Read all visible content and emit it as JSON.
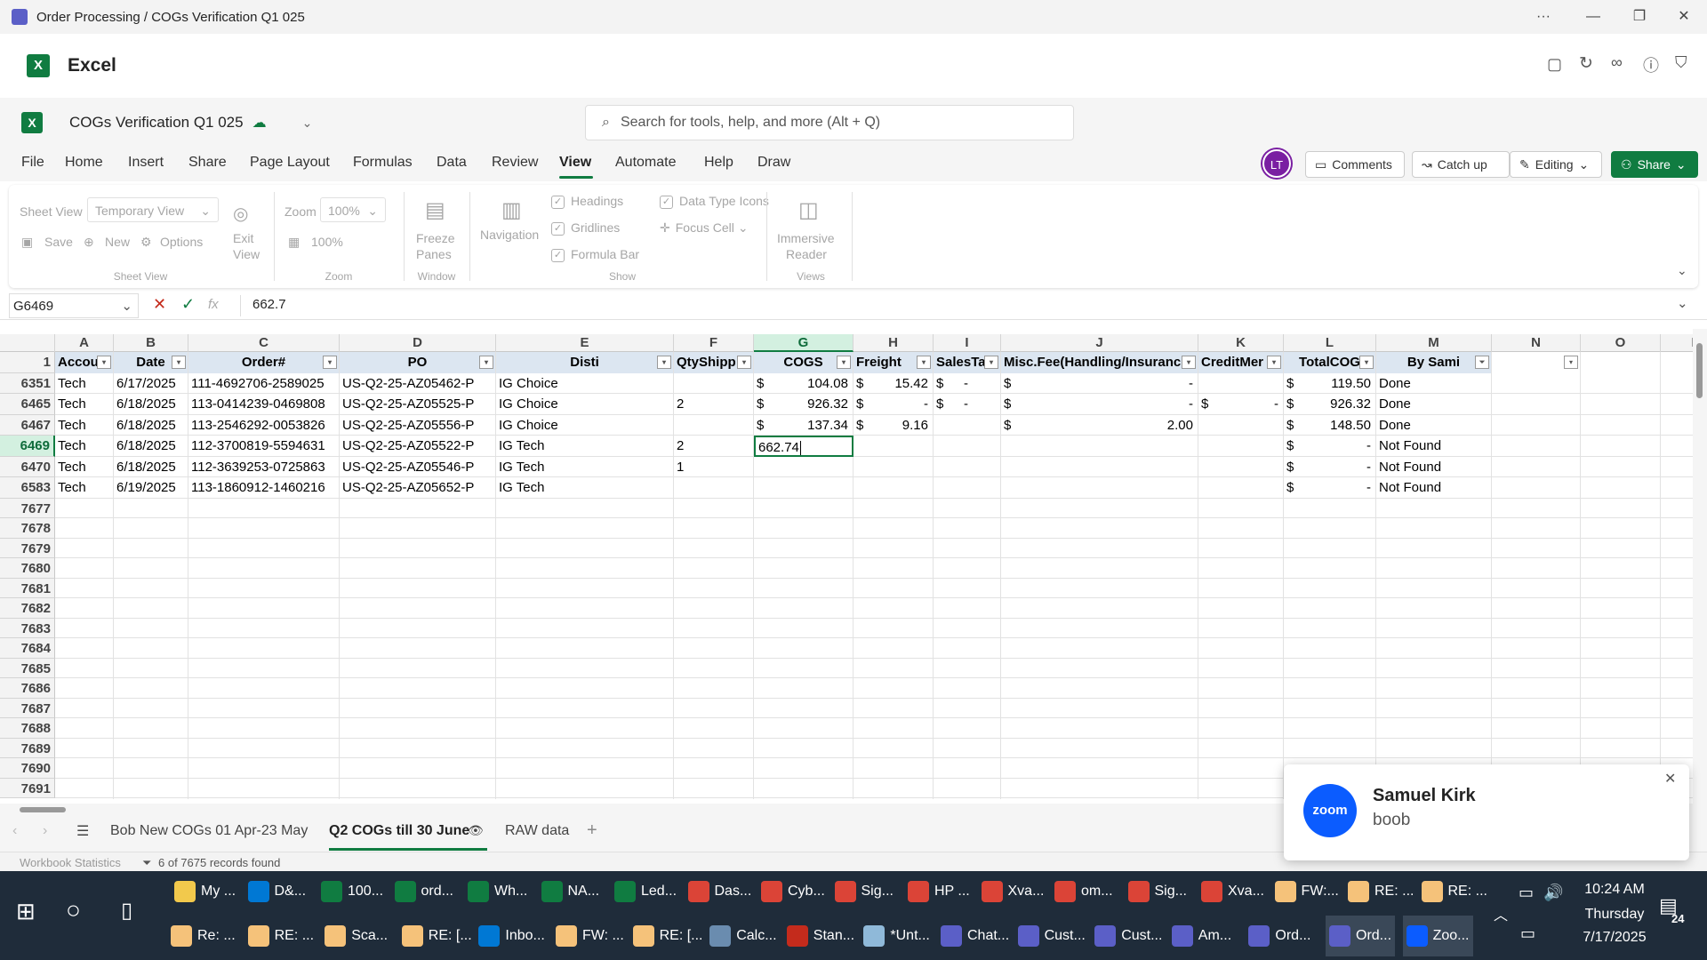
{
  "window": {
    "title": "Order Processing / COGs Verification Q1 025",
    "more": "···",
    "minimize": "—",
    "restore": "❐",
    "close": "✕"
  },
  "app": {
    "name": "Excel"
  },
  "doc": {
    "name": "COGs Verification Q1 025",
    "search_placeholder": "Search for tools, help, and more (Alt + Q)"
  },
  "menu": [
    "File",
    "Home",
    "Insert",
    "Share",
    "Page Layout",
    "Formulas",
    "Data",
    "Review",
    "View",
    "Automate",
    "Help",
    "Draw"
  ],
  "menu_active": "View",
  "header_buttons": {
    "avatar": "LT",
    "comments": "Comments",
    "catchup": "Catch up",
    "editing": "Editing",
    "share": "Share"
  },
  "ribbon": {
    "sheetview_label": "Sheet View",
    "sheetview_value": "Temporary View",
    "exit_view": [
      "Exit",
      "View"
    ],
    "save": "Save",
    "new": "New",
    "options": "Options",
    "group_sheetview": "Sheet View",
    "zoom_label": "Zoom",
    "zoom_value": "100%",
    "zoom_100": "100%",
    "group_zoom": "Zoom",
    "freeze": [
      "Freeze",
      "Panes"
    ],
    "group_window": "Window",
    "navigation": "Navigation",
    "headings": "Headings",
    "gridlines": "Gridlines",
    "formula_bar": "Formula Bar",
    "data_type_icons": "Data Type Icons",
    "focus_cell": "Focus Cell",
    "group_show": "Show",
    "immersive": [
      "Immersive",
      "Reader"
    ],
    "group_views": "Views"
  },
  "formula": {
    "namebox": "G6469",
    "fx": "fx",
    "value": "662.7"
  },
  "columns": [
    "A",
    "B",
    "C",
    "D",
    "E",
    "F",
    "G",
    "H",
    "I",
    "J",
    "K",
    "L",
    "M",
    "N",
    "O",
    "P"
  ],
  "selected_column": "G",
  "header_row": {
    "num": "1",
    "cells": [
      "Accou",
      "Date",
      "Order#",
      "PO",
      "Disti",
      "QtyShipp",
      "COGS",
      "Freight",
      "SalesTa",
      "Misc.Fee(Handling/Insuranc",
      "CreditMer",
      "TotalCOG",
      "By Sami",
      "",
      "",
      ""
    ]
  },
  "rows": [
    {
      "num": "6351",
      "A": "Tech",
      "B": "6/17/2025",
      "C": "111-4692706-2589025",
      "D": "US-Q2-25-AZ05462-P",
      "E": "IG Choice",
      "F": "",
      "G": "104.08",
      "H": "15.42",
      "I": "-",
      "J": "-",
      "K": "",
      "L": "119.50",
      "M": "Done"
    },
    {
      "num": "6465",
      "A": "Tech",
      "B": "6/18/2025",
      "C": "113-0414239-0469808",
      "D": "US-Q2-25-AZ05525-P",
      "E": "IG Choice",
      "F": "2",
      "G": "926.32",
      "H": "-",
      "I": "-",
      "J": "-",
      "K": "-",
      "L": "926.32",
      "M": "Done"
    },
    {
      "num": "6467",
      "A": "Tech",
      "B": "6/18/2025",
      "C": "113-2546292-0053826",
      "D": "US-Q2-25-AZ05556-P",
      "E": "IG Choice",
      "F": "",
      "G": "137.34",
      "H": "9.16",
      "I": "",
      "J": "2.00",
      "K": "",
      "L": "148.50",
      "M": "Done"
    },
    {
      "num": "6469",
      "A": "Tech",
      "B": "6/18/2025",
      "C": "112-3700819-5594631",
      "D": "US-Q2-25-AZ05522-P",
      "E": "IG Tech",
      "F": "2",
      "G": "662.74",
      "H": "",
      "I": "",
      "J": "",
      "K": "",
      "L": "-",
      "M": "Not Found",
      "editing": true
    },
    {
      "num": "6470",
      "A": "Tech",
      "B": "6/18/2025",
      "C": "112-3639253-0725863",
      "D": "US-Q2-25-AZ05546-P",
      "E": "IG Tech",
      "F": "1",
      "G": "",
      "H": "",
      "I": "",
      "J": "",
      "K": "",
      "L": "-",
      "M": "Not Found"
    },
    {
      "num": "6583",
      "A": "Tech",
      "B": "6/19/2025",
      "C": "113-1860912-1460216",
      "D": "US-Q2-25-AZ05652-P",
      "E": "IG Tech",
      "F": "",
      "G": "",
      "H": "",
      "I": "",
      "J": "",
      "K": "",
      "L": "-",
      "M": "Not Found"
    }
  ],
  "dollar_cols": {
    "6351": [
      "G",
      "H",
      "I",
      "J",
      "L"
    ],
    "6465": [
      "G",
      "H",
      "I",
      "J",
      "K",
      "L"
    ],
    "6467": [
      "G",
      "H",
      "J",
      "L"
    ],
    "6469": [
      "L"
    ],
    "6470": [
      "L"
    ],
    "6583": [
      "L"
    ]
  },
  "currency_symbol": "$",
  "empty_rows": [
    "7677",
    "7678",
    "7679",
    "7680",
    "7681",
    "7682",
    "7683",
    "7684",
    "7685",
    "7686",
    "7687",
    "7688",
    "7689",
    "7690",
    "7691"
  ],
  "sheet_tabs": [
    {
      "label": "Bob New COGs 01 Apr-23 May",
      "active": false
    },
    {
      "label": "Q2 COGs till 30 June",
      "active": true
    },
    {
      "label": "RAW data",
      "active": false
    }
  ],
  "status": {
    "workbook_stats": "Workbook Statistics",
    "records": "6 of 7675 records found"
  },
  "toast": {
    "app": "zoom",
    "name": "Samuel Kirk",
    "message": "boob"
  },
  "taskbar_row1": [
    "My ...",
    "D&...",
    "100...",
    "ord...",
    "Wh...",
    "NA...",
    "Led...",
    "Das...",
    "Cyb...",
    "Sig...",
    "HP ...",
    "Xva...",
    "om...",
    "Sig...",
    "Xva...",
    "FW:...",
    "RE: ...",
    "RE: ..."
  ],
  "taskbar_row2": [
    "Re: ...",
    "RE: ...",
    "Sca...",
    "RE: [...",
    "Inbo...",
    "FW: ...",
    "RE: [...",
    "Calc...",
    "Stan...",
    "*Unt...",
    "Chat...",
    "Cust...",
    "Cust...",
    "Am...",
    "Ord...",
    "Ord...",
    "Zoo..."
  ],
  "clock": {
    "time": "10:24 AM",
    "day": "Thursday",
    "date": "7/17/2025"
  },
  "notif_count": "24",
  "colors": {
    "excel_green": "#107c41",
    "header_fill": "#dce6f1",
    "taskbar": "#1f2c3a",
    "avatar": "#7a1fa2"
  }
}
